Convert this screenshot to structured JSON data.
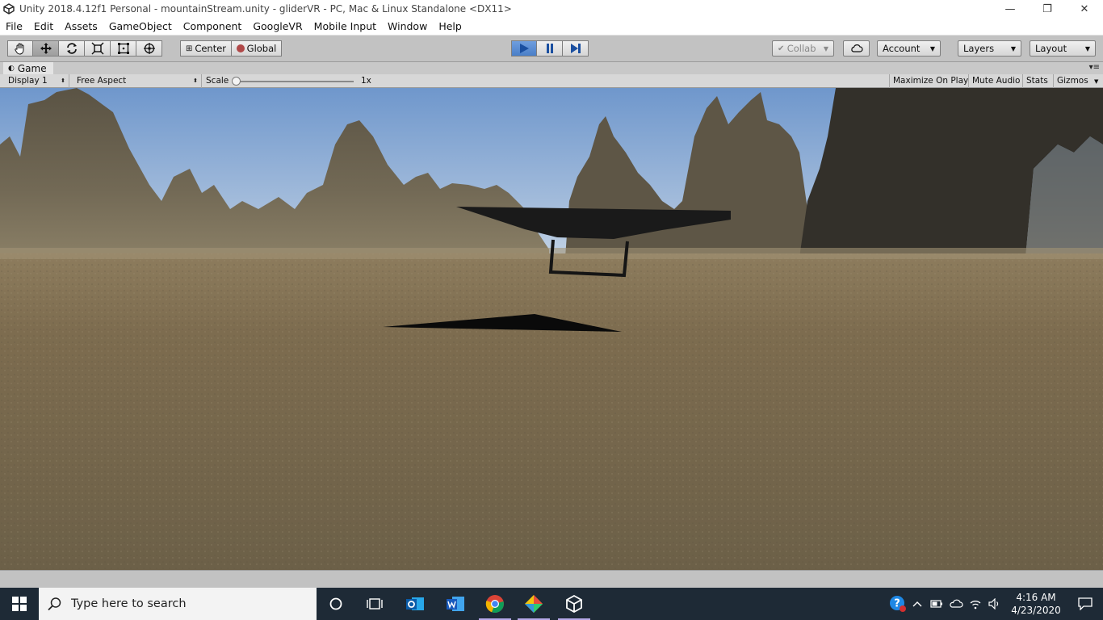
{
  "window": {
    "title": "Unity 2018.4.12f1 Personal - mountainStream.unity - gliderVR - PC, Mac & Linux Standalone <DX11>",
    "minimize_glyph": "—",
    "restore_glyph": "❐",
    "close_glyph": "✕"
  },
  "menu": [
    "File",
    "Edit",
    "Assets",
    "GameObject",
    "Component",
    "GoogleVR",
    "Mobile Input",
    "Window",
    "Help"
  ],
  "toolbar": {
    "pivot_label": "Center",
    "space_label": "Global",
    "collab_label": "Collab",
    "account_label": "Account",
    "layers_label": "Layers",
    "layout_label": "Layout",
    "play_active": true
  },
  "game_tab": {
    "label": "Game"
  },
  "game_controls": {
    "display": "Display 1",
    "aspect": "Free Aspect",
    "scale_label": "Scale",
    "scale_value": "1x",
    "maximize": "Maximize On Play",
    "mute": "Mute Audio",
    "stats": "Stats",
    "gizmos": "Gizmos"
  },
  "taskbar": {
    "search_placeholder": "Type here to search",
    "time": "4:16 AM",
    "date": "4/23/2020"
  },
  "colors": {
    "sky_top": "#6f97cc",
    "sky_horizon": "#c4d4e6",
    "ground": "#7b6a4e",
    "mountain": "#6a6150",
    "play_blue": "#4a7fc8",
    "taskbar": "#1e2a36"
  }
}
